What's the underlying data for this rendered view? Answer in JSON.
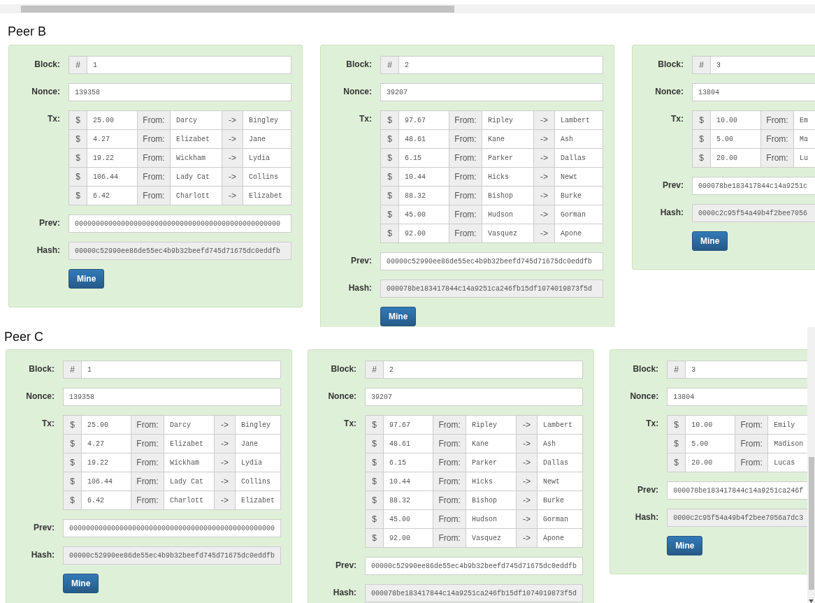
{
  "peers": [
    {
      "title": "Peer B",
      "blocks": [
        {
          "labels": {
            "block": "Block:",
            "number_prefix": "#",
            "nonce": "Nonce:",
            "tx": "Tx:",
            "prev": "Prev:",
            "hash": "Hash:"
          },
          "number": "1",
          "nonce": "139358",
          "prev": "0000000000000000000000000000000000000000000000000",
          "hash": "00000c52990ee86de55ec4b9b32beefd745d71675dc0eddfb",
          "button": "Mine",
          "txs": [
            {
              "currency": "$",
              "amount": "25.00",
              "from_label": "From:",
              "from": "Darcy",
              "arrow": "->",
              "to": "Bingley"
            },
            {
              "currency": "$",
              "amount": "4.27",
              "from_label": "From:",
              "from": "Elizabet",
              "arrow": "->",
              "to": "Jane"
            },
            {
              "currency": "$",
              "amount": "19.22",
              "from_label": "From:",
              "from": "Wickham",
              "arrow": "->",
              "to": "Lydia"
            },
            {
              "currency": "$",
              "amount": "106.44",
              "from_label": "From:",
              "from": "Lady Cat",
              "arrow": "->",
              "to": "Collins"
            },
            {
              "currency": "$",
              "amount": "6.42",
              "from_label": "From:",
              "from": "Charlott",
              "arrow": "->",
              "to": "Elizabet"
            }
          ]
        },
        {
          "labels": {
            "block": "Block:",
            "number_prefix": "#",
            "nonce": "Nonce:",
            "tx": "Tx:",
            "prev": "Prev:",
            "hash": "Hash:"
          },
          "number": "2",
          "nonce": "39207",
          "prev": "00000c52990ee86de55ec4b9b32beefd745d71675dc0eddfb",
          "hash": "000078be183417844c14a9251ca246fb15df1074019873f5d",
          "button": "Mine",
          "txs": [
            {
              "currency": "$",
              "amount": "97.67",
              "from_label": "From:",
              "from": "Ripley",
              "arrow": "->",
              "to": "Lambert"
            },
            {
              "currency": "$",
              "amount": "48.61",
              "from_label": "From:",
              "from": "Kane",
              "arrow": "->",
              "to": "Ash"
            },
            {
              "currency": "$",
              "amount": "6.15",
              "from_label": "From:",
              "from": "Parker",
              "arrow": "->",
              "to": "Dallas"
            },
            {
              "currency": "$",
              "amount": "10.44",
              "from_label": "From:",
              "from": "Hicks",
              "arrow": "->",
              "to": "Newt"
            },
            {
              "currency": "$",
              "amount": "88.32",
              "from_label": "From:",
              "from": "Bishop",
              "arrow": "->",
              "to": "Burke"
            },
            {
              "currency": "$",
              "amount": "45.00",
              "from_label": "From:",
              "from": "Hudson",
              "arrow": "->",
              "to": "Gorman"
            },
            {
              "currency": "$",
              "amount": "92.00",
              "from_label": "From:",
              "from": "Vasquez",
              "arrow": "->",
              "to": "Apone"
            }
          ]
        },
        {
          "labels": {
            "block": "Block:",
            "number_prefix": "#",
            "nonce": "Nonce:",
            "tx": "Tx:",
            "prev": "Prev:",
            "hash": "Hash:"
          },
          "number": "3",
          "nonce": "13804",
          "prev": "000078be183417844c14a9251c",
          "hash": "0000c2c95f54a49b4f2bee7056",
          "button": "Mine",
          "txs": [
            {
              "currency": "$",
              "amount": "10.00",
              "from_label": "From:",
              "from": "Em"
            },
            {
              "currency": "$",
              "amount": "5.00",
              "from_label": "From:",
              "from": "Ma"
            },
            {
              "currency": "$",
              "amount": "20.00",
              "from_label": "From:",
              "from": "Lu"
            }
          ]
        }
      ]
    },
    {
      "title": "Peer C",
      "blocks": [
        {
          "labels": {
            "block": "Block:",
            "number_prefix": "#",
            "nonce": "Nonce:",
            "tx": "Tx:",
            "prev": "Prev:",
            "hash": "Hash:"
          },
          "number": "1",
          "nonce": "139358",
          "prev": "0000000000000000000000000000000000000000000000000",
          "hash": "00000c52990ee86de55ec4b9b32beefd745d71675dc0eddfb",
          "button": "Mine",
          "txs": [
            {
              "currency": "$",
              "amount": "25.00",
              "from_label": "From:",
              "from": "Darcy",
              "arrow": "->",
              "to": "Bingley"
            },
            {
              "currency": "$",
              "amount": "4.27",
              "from_label": "From:",
              "from": "Elizabet",
              "arrow": "->",
              "to": "Jane"
            },
            {
              "currency": "$",
              "amount": "19.22",
              "from_label": "From:",
              "from": "Wickham",
              "arrow": "->",
              "to": "Lydia"
            },
            {
              "currency": "$",
              "amount": "106.44",
              "from_label": "From:",
              "from": "Lady Cat",
              "arrow": "->",
              "to": "Collins"
            },
            {
              "currency": "$",
              "amount": "6.42",
              "from_label": "From:",
              "from": "Charlott",
              "arrow": "->",
              "to": "Elizabet"
            }
          ]
        },
        {
          "labels": {
            "block": "Block:",
            "number_prefix": "#",
            "nonce": "Nonce:",
            "tx": "Tx:",
            "prev": "Prev:",
            "hash": "Hash:"
          },
          "number": "2",
          "nonce": "39207",
          "prev": "00000c52990ee86de55ec4b9b32beefd745d71675dc0eddfb",
          "hash": "000078be183417844c14a9251ca246fb15df1074019873f5d",
          "txs": [
            {
              "currency": "$",
              "amount": "97.67",
              "from_label": "From:",
              "from": "Ripley",
              "arrow": "->",
              "to": "Lambert"
            },
            {
              "currency": "$",
              "amount": "48.61",
              "from_label": "From:",
              "from": "Kane",
              "arrow": "->",
              "to": "Ash"
            },
            {
              "currency": "$",
              "amount": "6.15",
              "from_label": "From:",
              "from": "Parker",
              "arrow": "->",
              "to": "Dallas"
            },
            {
              "currency": "$",
              "amount": "10.44",
              "from_label": "From:",
              "from": "Hicks",
              "arrow": "->",
              "to": "Newt"
            },
            {
              "currency": "$",
              "amount": "88.32",
              "from_label": "From:",
              "from": "Bishop",
              "arrow": "->",
              "to": "Burke"
            },
            {
              "currency": "$",
              "amount": "45.00",
              "from_label": "From:",
              "from": "Hudson",
              "arrow": "->",
              "to": "Gorman"
            },
            {
              "currency": "$",
              "amount": "92.00",
              "from_label": "From:",
              "from": "Vasquez",
              "arrow": "->",
              "to": "Apone"
            }
          ]
        },
        {
          "labels": {
            "block": "Block:",
            "number_prefix": "#",
            "nonce": "Nonce:",
            "tx": "Tx:",
            "prev": "Prev:",
            "hash": "Hash:"
          },
          "number": "3",
          "nonce": "13804",
          "prev": "000078be183417844c14a9251ca246f",
          "hash": "0000c2c95f54a49b4f2bee7056a7dc3",
          "button": "Mine",
          "txs": [
            {
              "currency": "$",
              "amount": "10.00",
              "from_label": "From:",
              "from": "Emily"
            },
            {
              "currency": "$",
              "amount": "5.00",
              "from_label": "From:",
              "from": "Madison"
            },
            {
              "currency": "$",
              "amount": "20.00",
              "from_label": "From:",
              "from": "Lucas"
            }
          ]
        }
      ]
    }
  ]
}
